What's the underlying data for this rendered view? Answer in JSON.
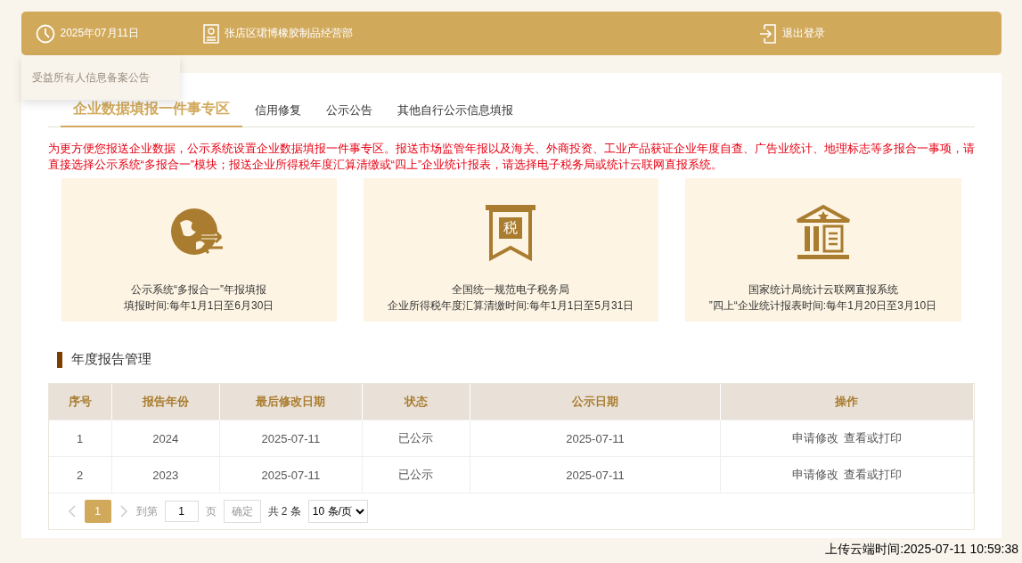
{
  "header": {
    "date": "2025年07月11日",
    "company": "张店区珺博橡胶制品经营部",
    "logout": "退出登录"
  },
  "dropdown": {
    "items": [
      "受益所有人信息备案公告"
    ]
  },
  "tabs": [
    {
      "label": "企业数据填报一件事专区",
      "selected": true
    },
    {
      "label": "信用修复",
      "selected": false
    },
    {
      "label": "公示公告",
      "selected": false
    },
    {
      "label": "其他自行公示信息填报",
      "selected": false
    }
  ],
  "notice": "为更方便您报送企业数据，公示系统设置企业数据填报一件事专区。报送市场监管年报以及海关、外商投资、工业产品获证企业年度自查、广告业统计、地理标志等多报合一事项，请直接选择公示系统“多报合一”模块；报送企业所得税年度汇算清缴或“四上”企业统计报表，请选择电子税务局或统计云联网直报系统。",
  "cards": [
    {
      "kind": "globe",
      "title": "公示系统“多报合一”年报填报",
      "subtitle": "填报时间:每年1月1日至6月30日"
    },
    {
      "kind": "tax",
      "icon_text": "税",
      "title": "全国统一规范电子税务局",
      "subtitle": "企业所得税年度汇算清缴时间:每年1月1日至5月31日"
    },
    {
      "kind": "bank",
      "title": "国家统计局统计云联网直报系统",
      "subtitle": "”四上“企业统计报表时间:每年1月20日至3月10日"
    }
  ],
  "section_title": "年度报告管理",
  "table": {
    "columns": [
      "序号",
      "报告年份",
      "最后修改日期",
      "状态",
      "公示日期",
      "操作"
    ],
    "rows": [
      {
        "cells": [
          "1",
          "2024",
          "2025-07-11",
          "已公示",
          "2025-07-11"
        ],
        "actions": [
          "申请修改",
          "查看或打印"
        ]
      },
      {
        "cells": [
          "2",
          "2023",
          "2025-07-11",
          "已公示",
          "2025-07-11"
        ],
        "actions": [
          "申请修改",
          "查看或打印"
        ]
      }
    ]
  },
  "pagination": {
    "pages": [
      {
        "label": "1",
        "selected": true
      }
    ],
    "goto_label": "到第",
    "page_input": "1",
    "page_unit": "页",
    "confirm": "确定",
    "total": "共 2 条",
    "page_size": "10 条/页"
  },
  "upload_time": "上传云端时间:2025-07-11 10:59:38"
}
